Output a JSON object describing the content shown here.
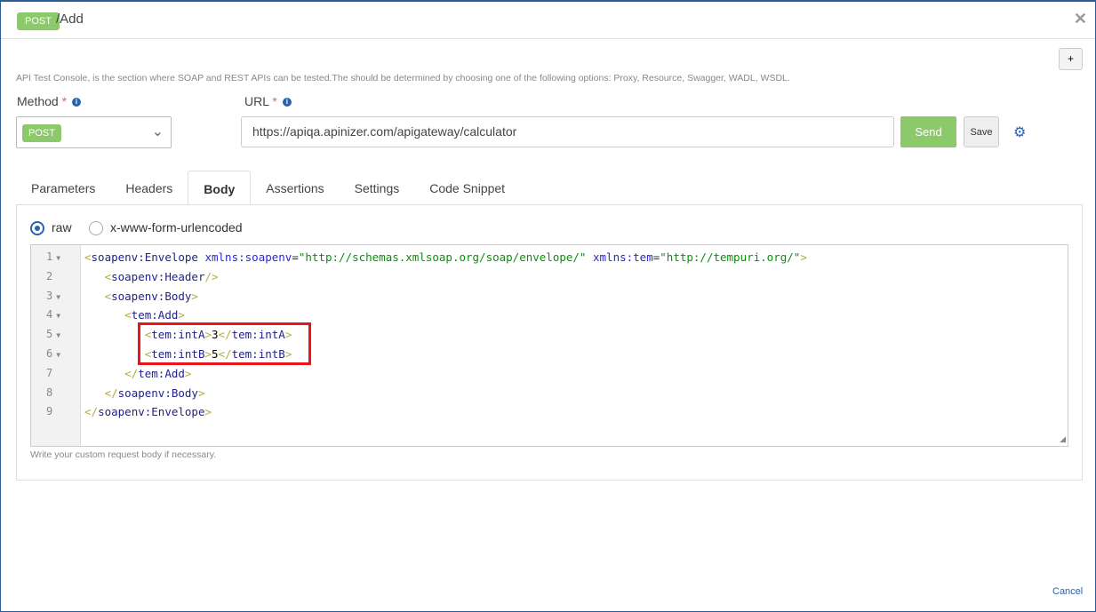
{
  "header": {
    "method_badge": "POST",
    "title": "/Add",
    "close": "✕"
  },
  "add_button": "+",
  "description": "API Test Console, is the section where SOAP and REST APIs can be tested.The should be determined by choosing one of the following options: Proxy, Resource, Swagger, WADL, WSDL.",
  "method": {
    "label": "Method",
    "required": "*",
    "value": "POST"
  },
  "url": {
    "label": "URL",
    "required": "*",
    "value": "https://apiqa.apinizer.com/apigateway/calculator"
  },
  "buttons": {
    "send": "Send",
    "save": "Save",
    "cancel": "Cancel"
  },
  "tabs": [
    "Parameters",
    "Headers",
    "Body",
    "Assertions",
    "Settings",
    "Code Snippet"
  ],
  "active_tab": "Body",
  "body_types": {
    "raw": "raw",
    "urlencoded": "x-www-form-urlencoded",
    "selected": "raw"
  },
  "editor": {
    "hint": "Write your custom request body if necessary.",
    "lines": [
      {
        "n": "1",
        "fold": true,
        "indent": "",
        "parts": [
          [
            "br",
            "<"
          ],
          [
            "tg",
            "soapenv:Envelope"
          ],
          [
            "tx",
            " "
          ],
          [
            "at",
            "xmlns:soapenv"
          ],
          [
            "eq",
            "="
          ],
          [
            "st",
            "\"http://schemas.xmlsoap.org/soap/envelope/\""
          ],
          [
            "tx",
            " "
          ],
          [
            "at",
            "xmlns:tem"
          ],
          [
            "eq",
            "="
          ],
          [
            "st",
            "\"http://tempuri.org/\""
          ],
          [
            "br",
            ">"
          ]
        ]
      },
      {
        "n": "2",
        "fold": false,
        "indent": "   ",
        "parts": [
          [
            "br",
            "<"
          ],
          [
            "tg",
            "soapenv:Header"
          ],
          [
            "br",
            "/>"
          ]
        ]
      },
      {
        "n": "3",
        "fold": true,
        "indent": "   ",
        "parts": [
          [
            "br",
            "<"
          ],
          [
            "tg",
            "soapenv:Body"
          ],
          [
            "br",
            ">"
          ]
        ]
      },
      {
        "n": "4",
        "fold": true,
        "indent": "      ",
        "parts": [
          [
            "br",
            "<"
          ],
          [
            "tg",
            "tem:Add"
          ],
          [
            "br",
            ">"
          ]
        ]
      },
      {
        "n": "5",
        "fold": true,
        "indent": "         ",
        "parts": [
          [
            "br",
            "<"
          ],
          [
            "tg",
            "tem:intA"
          ],
          [
            "br",
            ">"
          ],
          [
            "tx",
            "3"
          ],
          [
            "br",
            "</"
          ],
          [
            "tg",
            "tem:intA"
          ],
          [
            "br",
            ">"
          ]
        ]
      },
      {
        "n": "6",
        "fold": true,
        "indent": "         ",
        "parts": [
          [
            "br",
            "<"
          ],
          [
            "tg",
            "tem:intB"
          ],
          [
            "br",
            ">"
          ],
          [
            "tx",
            "5"
          ],
          [
            "br",
            "</"
          ],
          [
            "tg",
            "tem:intB"
          ],
          [
            "br",
            ">"
          ]
        ]
      },
      {
        "n": "7",
        "fold": false,
        "indent": "      ",
        "parts": [
          [
            "br",
            "</"
          ],
          [
            "tg",
            "tem:Add"
          ],
          [
            "br",
            ">"
          ]
        ]
      },
      {
        "n": "8",
        "fold": false,
        "indent": "   ",
        "parts": [
          [
            "br",
            "</"
          ],
          [
            "tg",
            "soapenv:Body"
          ],
          [
            "br",
            ">"
          ]
        ]
      },
      {
        "n": "9",
        "fold": false,
        "indent": "",
        "parts": [
          [
            "br",
            "</"
          ],
          [
            "tg",
            "soapenv:Envelope"
          ],
          [
            "br",
            ">"
          ]
        ]
      }
    ]
  }
}
